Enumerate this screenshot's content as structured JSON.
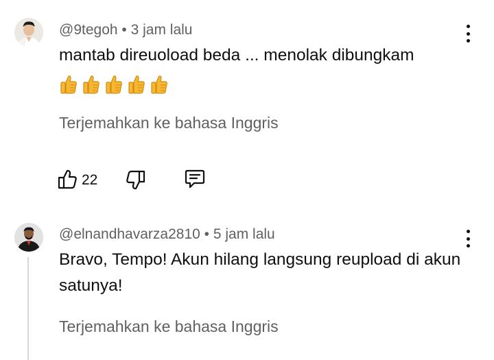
{
  "comments": [
    {
      "username": "@9tegoh",
      "separator": "•",
      "time": "3 jam lalu",
      "text": "mantab direuoload beda ... menolak dibungkam",
      "emoji": "👍👍👍👍👍",
      "translate_label": "Terjemahkan ke bahasa Inggris",
      "like_count": "22"
    },
    {
      "username": "@elnandhavarza2810",
      "separator": "•",
      "time": "5 jam lalu",
      "text": "Bravo, Tempo! Akun hilang langsung reupload di akun satunya!",
      "translate_label": "Terjemahkan ke bahasa Inggris"
    }
  ],
  "colors": {
    "text_primary": "#0f0f0f",
    "text_secondary": "#606060",
    "thread_line": "#d6d6d6",
    "emoji_thumb": "#f7b733"
  },
  "icons": [
    "more-vert-icon",
    "thumbs-up-icon",
    "thumbs-down-icon",
    "reply-icon"
  ]
}
